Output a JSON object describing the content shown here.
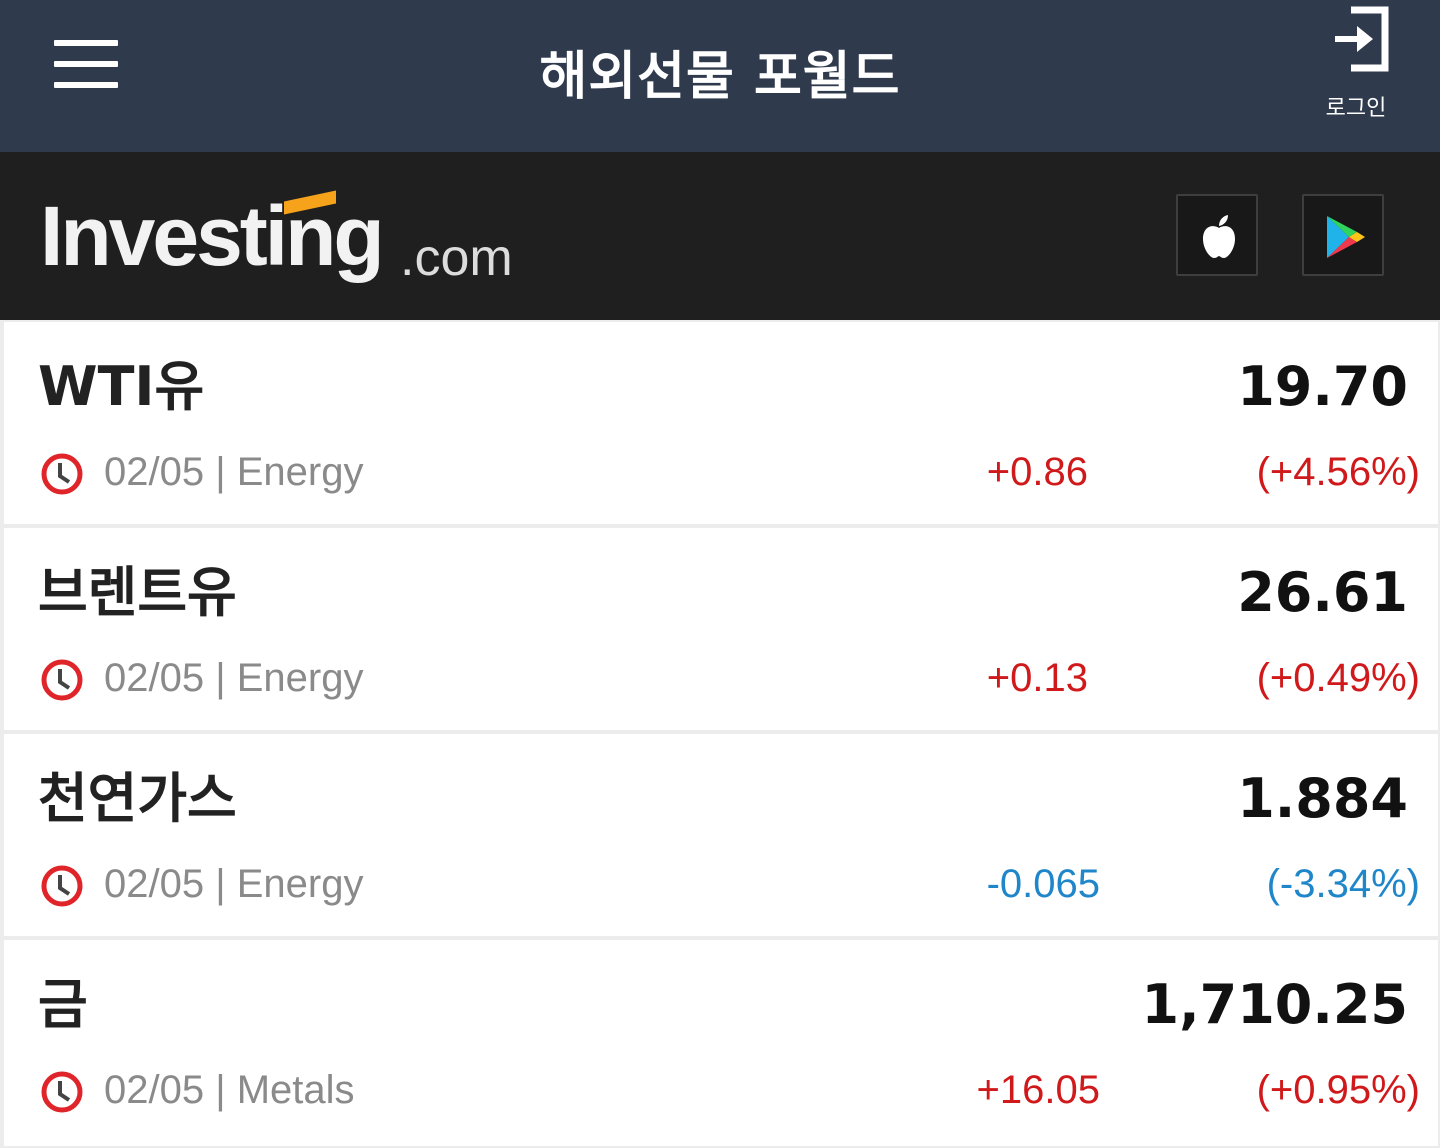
{
  "header": {
    "menu_icon": "hamburger-menu-icon",
    "title": "해외선물 포월드",
    "login_icon": "login-arrow-icon",
    "login_label": "로그인"
  },
  "brand": {
    "logo_text": "Investing",
    "logo_suffix": ".com",
    "logo_accent_color": "#f7a21b",
    "app_store_icon": "apple-icon",
    "play_store_icon": "google-play-icon"
  },
  "colors": {
    "header_bg": "#2f3a4d",
    "brand_bg": "#1f1f1f",
    "up": "#d0191b",
    "down": "#1f86c9",
    "clock_icon": "#e0252a"
  },
  "quotes": [
    {
      "name": "WTI유",
      "price": "19.70",
      "time": "02/05",
      "category": "Energy",
      "meta": "02/05 | Energy",
      "change": "+0.86",
      "change_pct": "(+4.56%)",
      "direction": "up"
    },
    {
      "name": "브렌트유",
      "price": "26.61",
      "time": "02/05",
      "category": "Energy",
      "meta": "02/05 | Energy",
      "change": "+0.13",
      "change_pct": "(+0.49%)",
      "direction": "up"
    },
    {
      "name": "천연가스",
      "price": "1.884",
      "time": "02/05",
      "category": "Energy",
      "meta": "02/05 | Energy",
      "change": "-0.065",
      "change_pct": "(-3.34%)",
      "direction": "down"
    },
    {
      "name": "금",
      "price": "1,710.25",
      "time": "02/05",
      "category": "Metals",
      "meta": "02/05 | Metals",
      "change": "+16.05",
      "change_pct": "(+0.95%)",
      "direction": "up"
    }
  ]
}
